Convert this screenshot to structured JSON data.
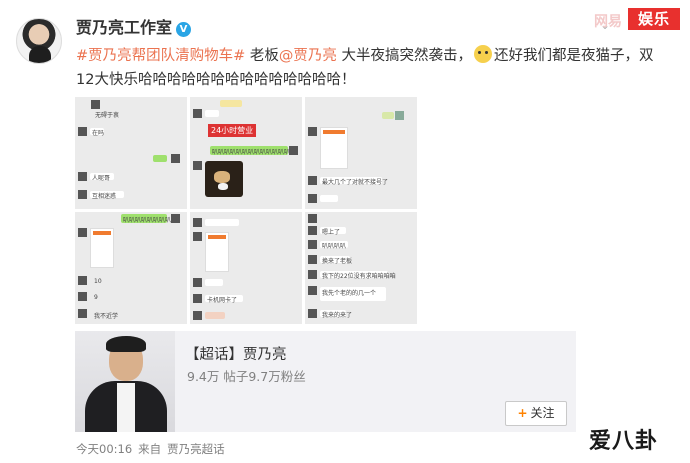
{
  "post": {
    "author": "贾乃亮工作室",
    "verified_icon": "verified-v-icon",
    "text_tag": "#贾乃亮帮团队清购物车#",
    "text_a": " 老板",
    "text_mention": "@贾乃亮",
    "text_b": " 大半夜搞突然袭击，",
    "text_emoji": "doge-emoji",
    "text_c": "还好我们都是夜猫子，双12大快乐哈哈哈哈哈哈哈哈哈哈哈哈哈哈！"
  },
  "images": {
    "img1_caption_top": "无碍于衷",
    "img1_caption_2": "在吗",
    "img1_caption_3": "人呢哥",
    "img1_caption_4": "互相迷惑",
    "img2_badge": "24小时营业",
    "img2_green": "叭叭叭叭叭叭叭叭叭叭叭叭叭",
    "img3_caption": "最大几个了对就不接号了",
    "img4_green": "叭叭叭叭叭叭叭叭",
    "img4_caption_1": "10",
    "img4_caption_2": "9",
    "img4_caption_3": "我不近学",
    "img5_caption": "卡机网卡了",
    "img6_caption_1": "嗯上了",
    "img6_caption_2": "叭叭叭叭",
    "img6_caption_3": "换来了老板",
    "img6_caption_4": "我下的22位没有求咱咱咱咱",
    "img6_caption_5": "我先个老的的几一个",
    "img6_caption_6": "我来的来了"
  },
  "card": {
    "title": "【超话】贾乃亮",
    "stats": "9.4万 帖子9.7万粉丝",
    "follow_label": "关注",
    "follow_icon": "plus-icon"
  },
  "meta": {
    "time": "今天00:16",
    "source_prefix": "来自",
    "source": "贾乃亮超话"
  },
  "watermarks": {
    "top_badge": "娱乐",
    "top_faint": "网易",
    "bottom": "爱八卦"
  },
  "colors": {
    "link": "#eb7350",
    "verified": "#2aa5e5",
    "follow_plus": "#ff8200",
    "wechat_green": "#9fe06d",
    "badge_red": "#e8302e"
  }
}
